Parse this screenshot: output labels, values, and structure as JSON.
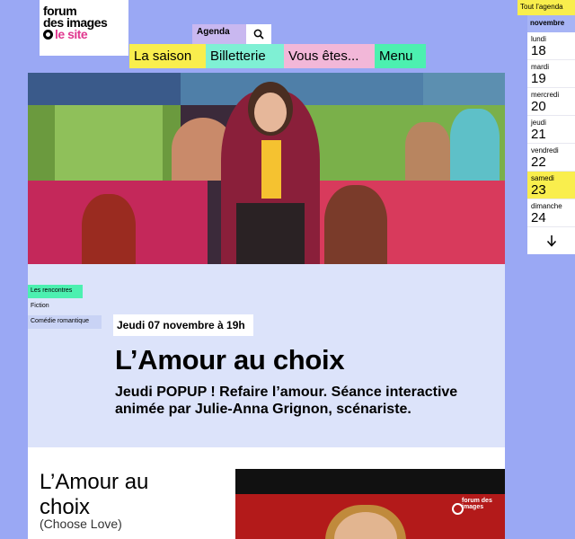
{
  "logo": {
    "line1": "forum",
    "line2": "des images",
    "line3": "le site"
  },
  "header": {
    "agenda": "Agenda"
  },
  "nav": {
    "saison": "La saison",
    "billetterie": "Billetterie",
    "vous": "Vous êtes...",
    "menu": "Menu"
  },
  "tags": {
    "rencontres": "Les rencontres",
    "fiction": "Fiction",
    "comedie": "Comédie romantique"
  },
  "event": {
    "date": "Jeudi 07 novembre à 19h",
    "title": "L’Amour au choix",
    "subtitle": "Jeudi POPUP ! Refaire l’amour. Séance interactive animée par Julie-Anna Grignon, scénariste."
  },
  "film": {
    "title": "L’Amour au choix",
    "original": "(Choose Love)",
    "watermark": "forum des images"
  },
  "calendar": {
    "tout": "Tout l’agenda",
    "month": "novembre",
    "days": [
      {
        "name": "lundi",
        "num": "18"
      },
      {
        "name": "mardi",
        "num": "19"
      },
      {
        "name": "mercredi",
        "num": "20"
      },
      {
        "name": "jeudi",
        "num": "21"
      },
      {
        "name": "vendredi",
        "num": "22"
      },
      {
        "name": "samedi",
        "num": "23"
      },
      {
        "name": "dimanche",
        "num": "24"
      }
    ]
  }
}
